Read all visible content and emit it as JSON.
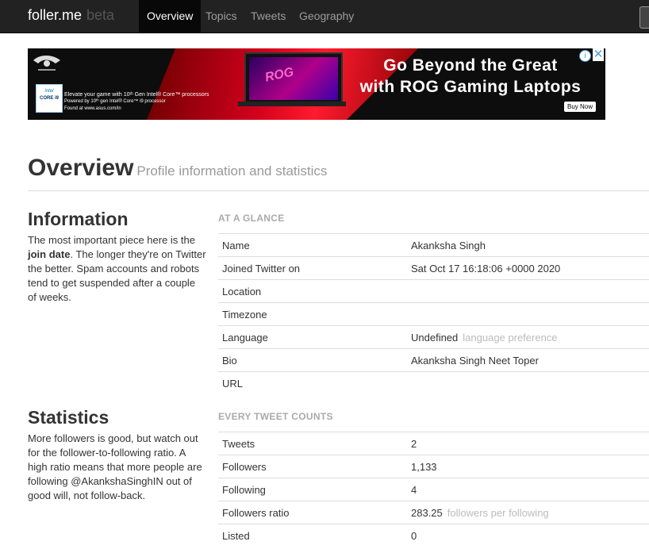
{
  "nav": {
    "brand": "foller.me",
    "brand_suffix": "beta",
    "items": [
      "Overview",
      "Topics",
      "Tweets",
      "Geography"
    ],
    "active": "Overview"
  },
  "ad": {
    "headline_line1": "Go Beyond the Great",
    "headline_line2": "with ROG Gaming Laptops",
    "buy_button": "Buy Now",
    "intel_badge_line1": "intel",
    "intel_badge_line2": "CORE i9",
    "small_line1": "Elevate your game with 10ᵗʰ Gen Intel® Core™ processors",
    "small_line2": "Powered by 10ᵗʰ gen Intel® Core™ i9 processor",
    "small_line3": "Found at www.asus.com/in",
    "screen_text": "ROG"
  },
  "header": {
    "title": "Overview",
    "subtitle": "Profile information and statistics"
  },
  "information": {
    "title": "Information",
    "desc_before": "The most important piece here is the ",
    "desc_bold": "join date",
    "desc_after": ". The longer they're on Twitter the better. Spam accounts and robots tend to get suspended after a couple of weeks.",
    "table_heading": "AT A GLANCE",
    "rows": [
      {
        "label": "Name",
        "value": "Akanksha Singh",
        "note": ""
      },
      {
        "label": "Joined Twitter on",
        "value": "Sat Oct 17 16:18:06 +0000 2020",
        "note": ""
      },
      {
        "label": "Location",
        "value": "",
        "note": ""
      },
      {
        "label": "Timezone",
        "value": "",
        "note": ""
      },
      {
        "label": "Language",
        "value": "Undefined",
        "note": "language preference"
      },
      {
        "label": "Bio",
        "value": "Akanksha Singh Neet Toper",
        "note": ""
      },
      {
        "label": "URL",
        "value": "",
        "note": ""
      }
    ]
  },
  "statistics": {
    "title": "Statistics",
    "desc": "More followers is good, but watch out for the follower-to-following ratio. A high ratio means that more people are following @AkankshaSinghIN out of good will, not follow-back.",
    "table_heading": "EVERY TWEET COUNTS",
    "rows": [
      {
        "label": "Tweets",
        "value": "2",
        "note": ""
      },
      {
        "label": "Followers",
        "value": "1,133",
        "note": ""
      },
      {
        "label": "Following",
        "value": "4",
        "note": ""
      },
      {
        "label": "Followers ratio",
        "value": "283.25",
        "note": "followers per following"
      },
      {
        "label": "Listed",
        "value": "0",
        "note": ""
      }
    ]
  }
}
